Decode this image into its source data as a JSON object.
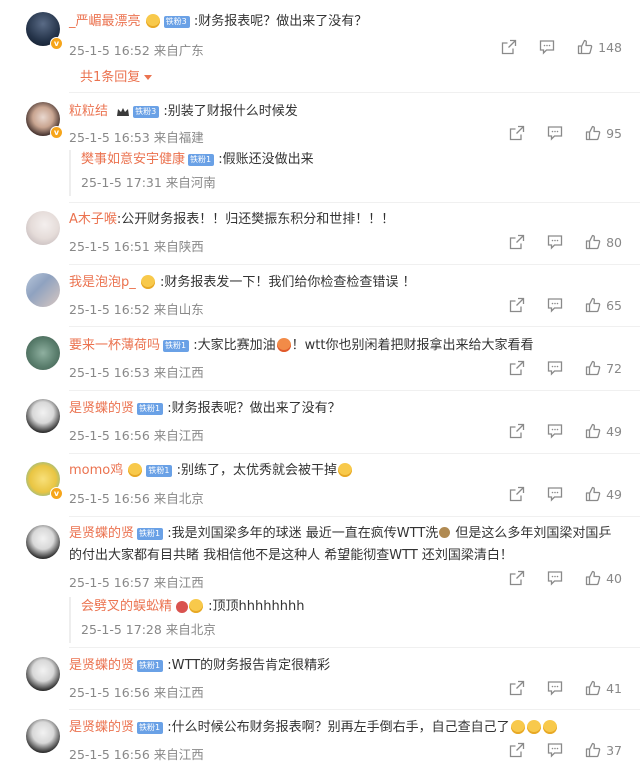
{
  "comments": [
    {
      "user": "_严嵋最漂亮",
      "badge": "铁粉3",
      "text": ":财务报表呢？做出来了没有？",
      "time": "25-1-5 16:52 来自广东",
      "likes": "148",
      "more_replies": "共1条回复"
    },
    {
      "user": "粒粒结",
      "badge": "铁粉3",
      "text": ":别装了财报什么时候发",
      "time": "25-1-5 16:53 来自福建",
      "likes": "95",
      "reply": {
        "user": "樊事如意安宇健康",
        "badge": "铁粉1",
        "text": ":假账还没做出来",
        "time": "25-1-5 17:31 来自河南"
      }
    },
    {
      "user": "A木子喉",
      "text": ":公开财务报表！！归还樊振东积分和世排！！！",
      "time": "25-1-5 16:51 来自陕西",
      "likes": "80"
    },
    {
      "user": "我是泡泡p_",
      "text": ":财务报表发一下！我们给你检查检查错误 ！",
      "time": "25-1-5 16:52 来自山东",
      "likes": "65"
    },
    {
      "user": "要来一杯薄荷吗",
      "badge": "铁粉1",
      "text_a": ":大家比赛加油",
      "text_b": "！wtt你也别闲着把财报拿出来给大家看看",
      "time": "25-1-5 16:53 来自江西",
      "likes": "72"
    },
    {
      "user": "是贤蝶的贤",
      "badge": "铁粉1",
      "text": ":财务报表呢？做出来了没有？",
      "time": "25-1-5 16:56 来自江西",
      "likes": "49"
    },
    {
      "user": "momo鸡",
      "badge": "铁粉1",
      "text": ":别练了，太优秀就会被干掉",
      "time": "25-1-5 16:56 来自北京",
      "likes": "49"
    },
    {
      "user": "是贤蝶的贤",
      "badge": "铁粉1",
      "text_line1": ":我是刘国梁多年的球迷 最近一直在疯传WTT洗",
      "text_line1b": " 但是这么多年刘国梁对国乒",
      "text_line2": "的付出大家都有目共睹 我相信他不是这种人 希望能彻查WTT 还刘国梁清白！",
      "time": "25-1-5 16:57 来自江西",
      "likes": "40",
      "reply": {
        "user": "会劈叉的蜈蚣精",
        "text": ":顶顶hhhhhhhh",
        "time": "25-1-5 17:28 来自北京"
      }
    },
    {
      "user": "是贤蝶的贤",
      "badge": "铁粉1",
      "text": ":WTT的财务报告肯定很精彩",
      "time": "25-1-5 16:56 来自江西",
      "likes": "41"
    },
    {
      "user": "是贤蝶的贤",
      "badge": "铁粉1",
      "text": ":什么时候公布财务报表啊？别再左手倒右手，自己查自己了",
      "time": "25-1-5 16:56 来自江西",
      "likes": "37"
    }
  ],
  "colors": {
    "username": "#eb7350",
    "meta": "#888888",
    "badge": "#6aa1e6",
    "vip_dot": "#f6a51b"
  }
}
